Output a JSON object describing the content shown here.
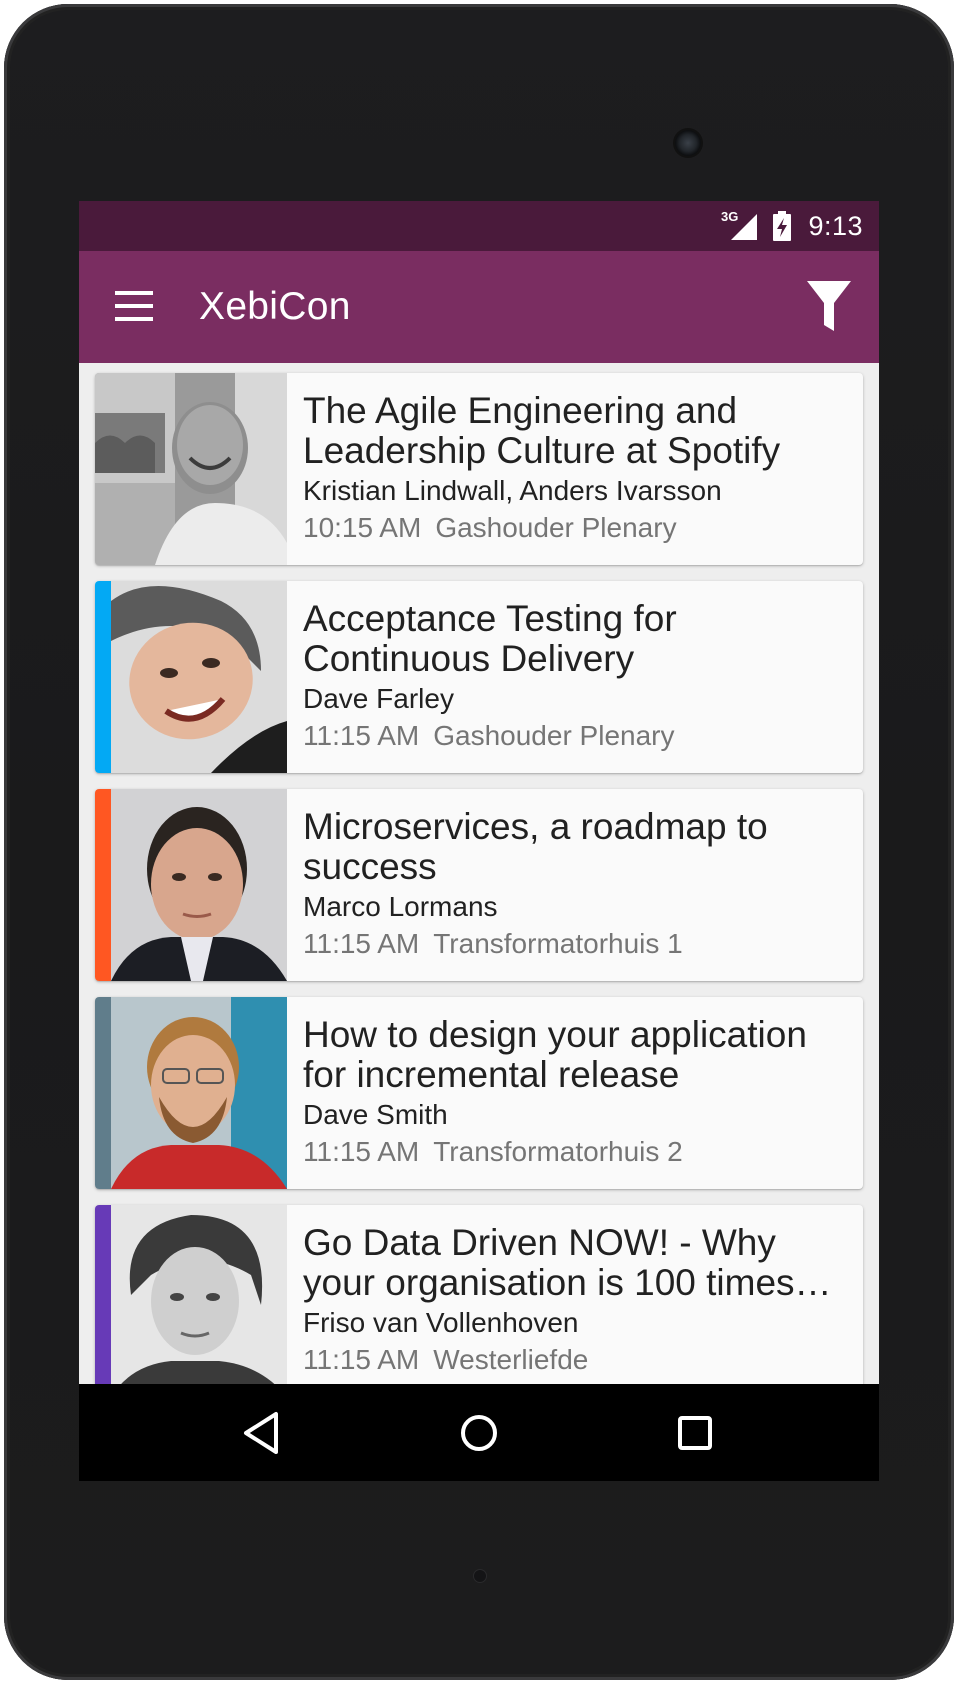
{
  "status_bar": {
    "network": "3G",
    "time": "9:13"
  },
  "app_bar": {
    "title": "XebiCon",
    "menu_icon": "hamburger-menu-icon",
    "filter_icon": "filter-funnel-icon"
  },
  "colors": {
    "status_bar": "#4a1a3b",
    "app_bar": "#7a2d61",
    "background": "#eeeeee",
    "card": "#fafafa"
  },
  "sessions": [
    {
      "title": "The Agile Engineering and Leadership Culture at Spotify",
      "speakers": "Kristian Lindwall, Anders Ivarsson",
      "time": "10:15 AM",
      "room": "Gashouder Plenary",
      "accent_color": null
    },
    {
      "title": "Acceptance Testing for Continuous Delivery",
      "speakers": "Dave Farley",
      "time": "11:15 AM",
      "room": "Gashouder Plenary",
      "accent_color": "#03a9f4"
    },
    {
      "title": "Microservices, a roadmap to success",
      "speakers": "Marco Lormans",
      "time": "11:15 AM",
      "room": "Transformatorhuis 1",
      "accent_color": "#ff5722"
    },
    {
      "title": "How to design your application for incremental release",
      "speakers": "Dave Smith",
      "time": "11:15 AM",
      "room": "Transformatorhuis 2",
      "accent_color": "#607d8b"
    },
    {
      "title": "Go Data Driven NOW! - Why your organisation is 100 times t…",
      "speakers": "Friso van Vollenhoven",
      "time": "11:15 AM",
      "room": "Westerliefde",
      "accent_color": "#673ab7"
    }
  ],
  "nav_bar": {
    "back_icon": "back-triangle-icon",
    "home_icon": "home-circle-icon",
    "recents_icon": "recents-square-icon"
  }
}
